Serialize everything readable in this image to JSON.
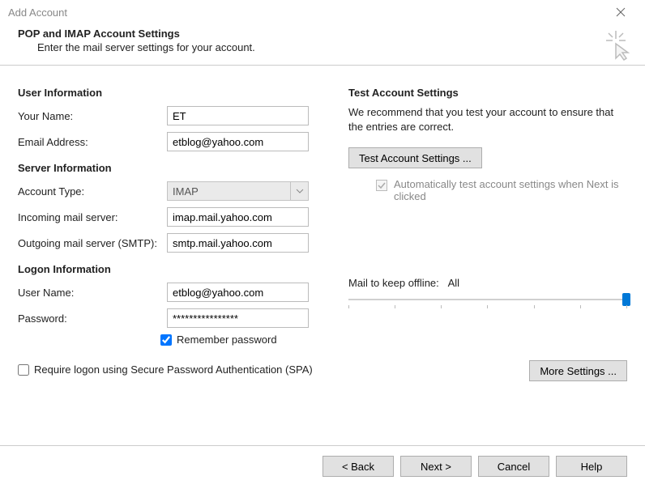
{
  "window": {
    "title": "Add Account",
    "header_title": "POP and IMAP Account Settings",
    "header_subtitle": "Enter the mail server settings for your account."
  },
  "sections": {
    "user_info": "User Information",
    "server_info": "Server Information",
    "logon_info": "Logon Information",
    "test_settings": "Test Account Settings"
  },
  "labels": {
    "your_name": "Your Name:",
    "email_address": "Email Address:",
    "account_type": "Account Type:",
    "incoming": "Incoming mail server:",
    "outgoing": "Outgoing mail server (SMTP):",
    "user_name": "User Name:",
    "password": "Password:",
    "remember_pw": "Remember password",
    "require_spa": "Require logon using Secure Password Authentication (SPA)",
    "test_text": "We recommend that you test your account to ensure that the entries are correct.",
    "auto_test": "Automatically test account settings when Next is clicked",
    "mail_offline": "Mail to keep offline:",
    "mail_offline_value": "All"
  },
  "values": {
    "your_name": "ET",
    "email_address": "etblog@yahoo.com",
    "account_type": "IMAP",
    "incoming": "imap.mail.yahoo.com",
    "outgoing": "smtp.mail.yahoo.com",
    "user_name": "etblog@yahoo.com",
    "password": "****************",
    "remember_pw_checked": true,
    "require_spa_checked": false,
    "auto_test_checked": true
  },
  "buttons": {
    "test": "Test Account Settings ...",
    "more": "More Settings ...",
    "back": "< Back",
    "next": "Next >",
    "cancel": "Cancel",
    "help": "Help"
  },
  "icons": {
    "close": "close-icon",
    "chevron_down": "chevron-down-icon",
    "cursor_star": "cursor-star-icon"
  }
}
